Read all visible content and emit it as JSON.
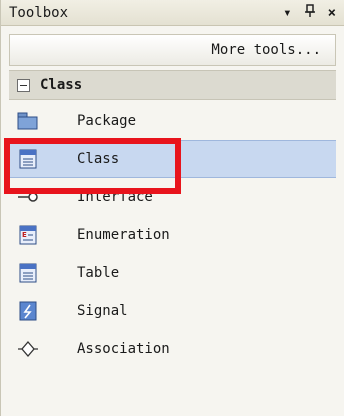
{
  "window": {
    "title": "Toolbox",
    "pin_glyph": "ᵖ",
    "close_glyph": "×",
    "dropdown_glyph": "▾"
  },
  "toolbar": {
    "more_tools": "More tools..."
  },
  "category": {
    "label": "Class"
  },
  "items": [
    {
      "label": "Package",
      "icon": "package-icon"
    },
    {
      "label": "Class",
      "icon": "class-icon",
      "selected": true
    },
    {
      "label": "Interface",
      "icon": "interface-icon"
    },
    {
      "label": "Enumeration",
      "icon": "enumeration-icon"
    },
    {
      "label": "Table",
      "icon": "table-icon"
    },
    {
      "label": "Signal",
      "icon": "signal-icon"
    },
    {
      "label": "Association",
      "icon": "association-icon"
    }
  ],
  "colors": {
    "accent_red": "#e8141c",
    "selection": "#c8d8f0"
  }
}
